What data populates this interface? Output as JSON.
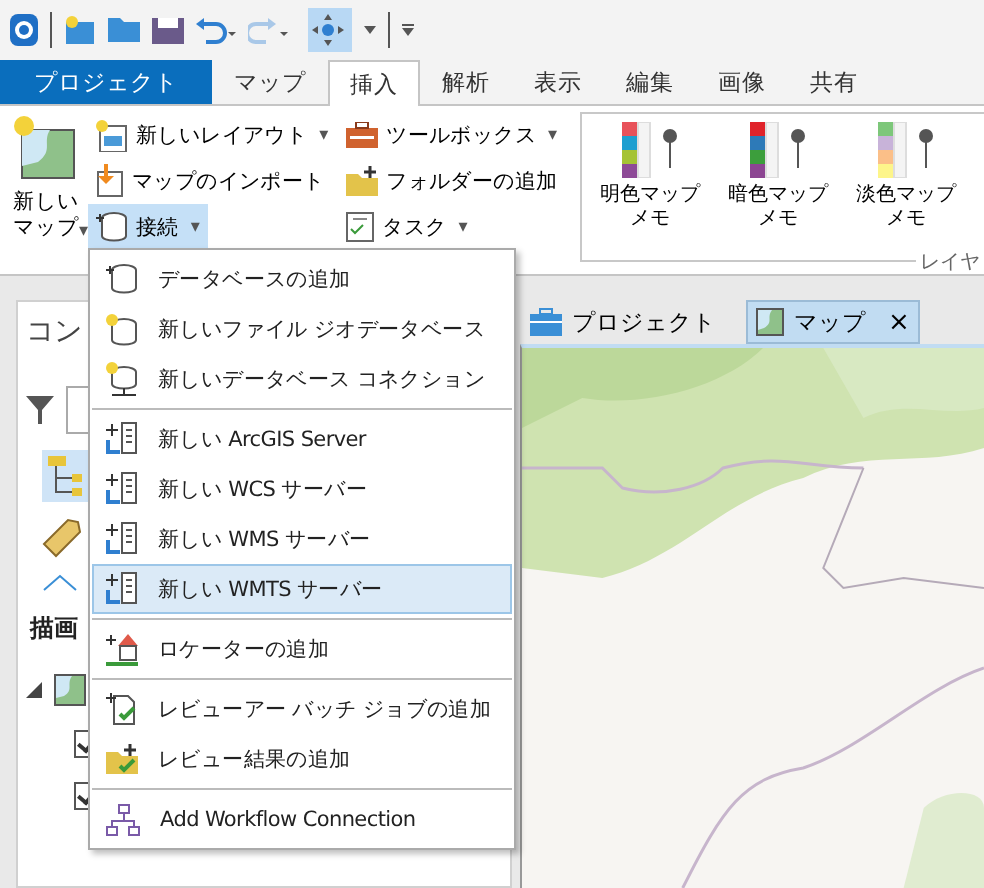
{
  "ribbon_tabs": [
    {
      "label": "プロジェクト",
      "kind": "backstage",
      "selected": false
    },
    {
      "label": "マップ",
      "kind": "tab",
      "selected": false
    },
    {
      "label": "挿入",
      "kind": "tab",
      "selected": true
    },
    {
      "label": "解析",
      "kind": "tab",
      "selected": false
    },
    {
      "label": "表示",
      "kind": "tab",
      "selected": false
    },
    {
      "label": "編集",
      "kind": "tab",
      "selected": false
    },
    {
      "label": "画像",
      "kind": "tab",
      "selected": false
    },
    {
      "label": "共有",
      "kind": "tab",
      "selected": false
    }
  ],
  "ribbon": {
    "new_map": {
      "label": "新しいマップ",
      "caret": "▾"
    },
    "column_1": [
      {
        "label": "新しいレイアウト",
        "caret": "▾",
        "selected": false
      },
      {
        "label": "マップのインポート",
        "selected": false
      },
      {
        "label": "接続",
        "caret": "▾",
        "selected": true
      }
    ],
    "column_2": [
      {
        "label": "ツールボックス",
        "caret": "▾",
        "selected": false
      },
      {
        "label": "フォルダーの追加",
        "selected": false
      },
      {
        "label": "タスク",
        "caret": "▾",
        "selected": false
      }
    ],
    "gallery": [
      {
        "label": "明色マップメモ"
      },
      {
        "label": "暗色マップメモ"
      },
      {
        "label": "淡色マップメモ"
      }
    ],
    "group_label": "レイヤ"
  },
  "contents_pane": {
    "title": "コン",
    "section": "描画",
    "tree_expanded": true,
    "layers": [
      {
        "checked": true
      },
      {
        "checked": true
      }
    ]
  },
  "view_tabs": [
    {
      "label": "プロジェクト",
      "selected": false
    },
    {
      "label": "マップ",
      "selected": true,
      "close": "×"
    }
  ],
  "connect_menu": [
    [
      {
        "label": "データベースの追加",
        "kind": "database",
        "selected": false
      },
      {
        "label": "新しいファイル ジオデータベース",
        "kind": "new-database",
        "selected": false
      },
      {
        "label": "新しいデータベース コネクション",
        "kind": "connection",
        "selected": false
      }
    ],
    [
      {
        "label": "新しい ArcGIS Server",
        "kind": "server",
        "selected": false
      },
      {
        "label": "新しい WCS サーバー",
        "kind": "server",
        "selected": false
      },
      {
        "label": "新しい WMS サーバー",
        "kind": "server",
        "selected": false
      },
      {
        "label": "新しい WMTS サーバー",
        "kind": "server",
        "selected": true
      }
    ],
    [
      {
        "label": "ロケーターの追加",
        "kind": "locator",
        "selected": false
      }
    ],
    [
      {
        "label": "レビューアー バッチ ジョブの追加",
        "kind": "batch",
        "selected": false
      },
      {
        "label": "レビュー結果の追加",
        "kind": "review",
        "selected": false
      }
    ],
    [
      {
        "label": "Add Workflow Connection",
        "kind": "workflow",
        "selected": false
      }
    ]
  ]
}
